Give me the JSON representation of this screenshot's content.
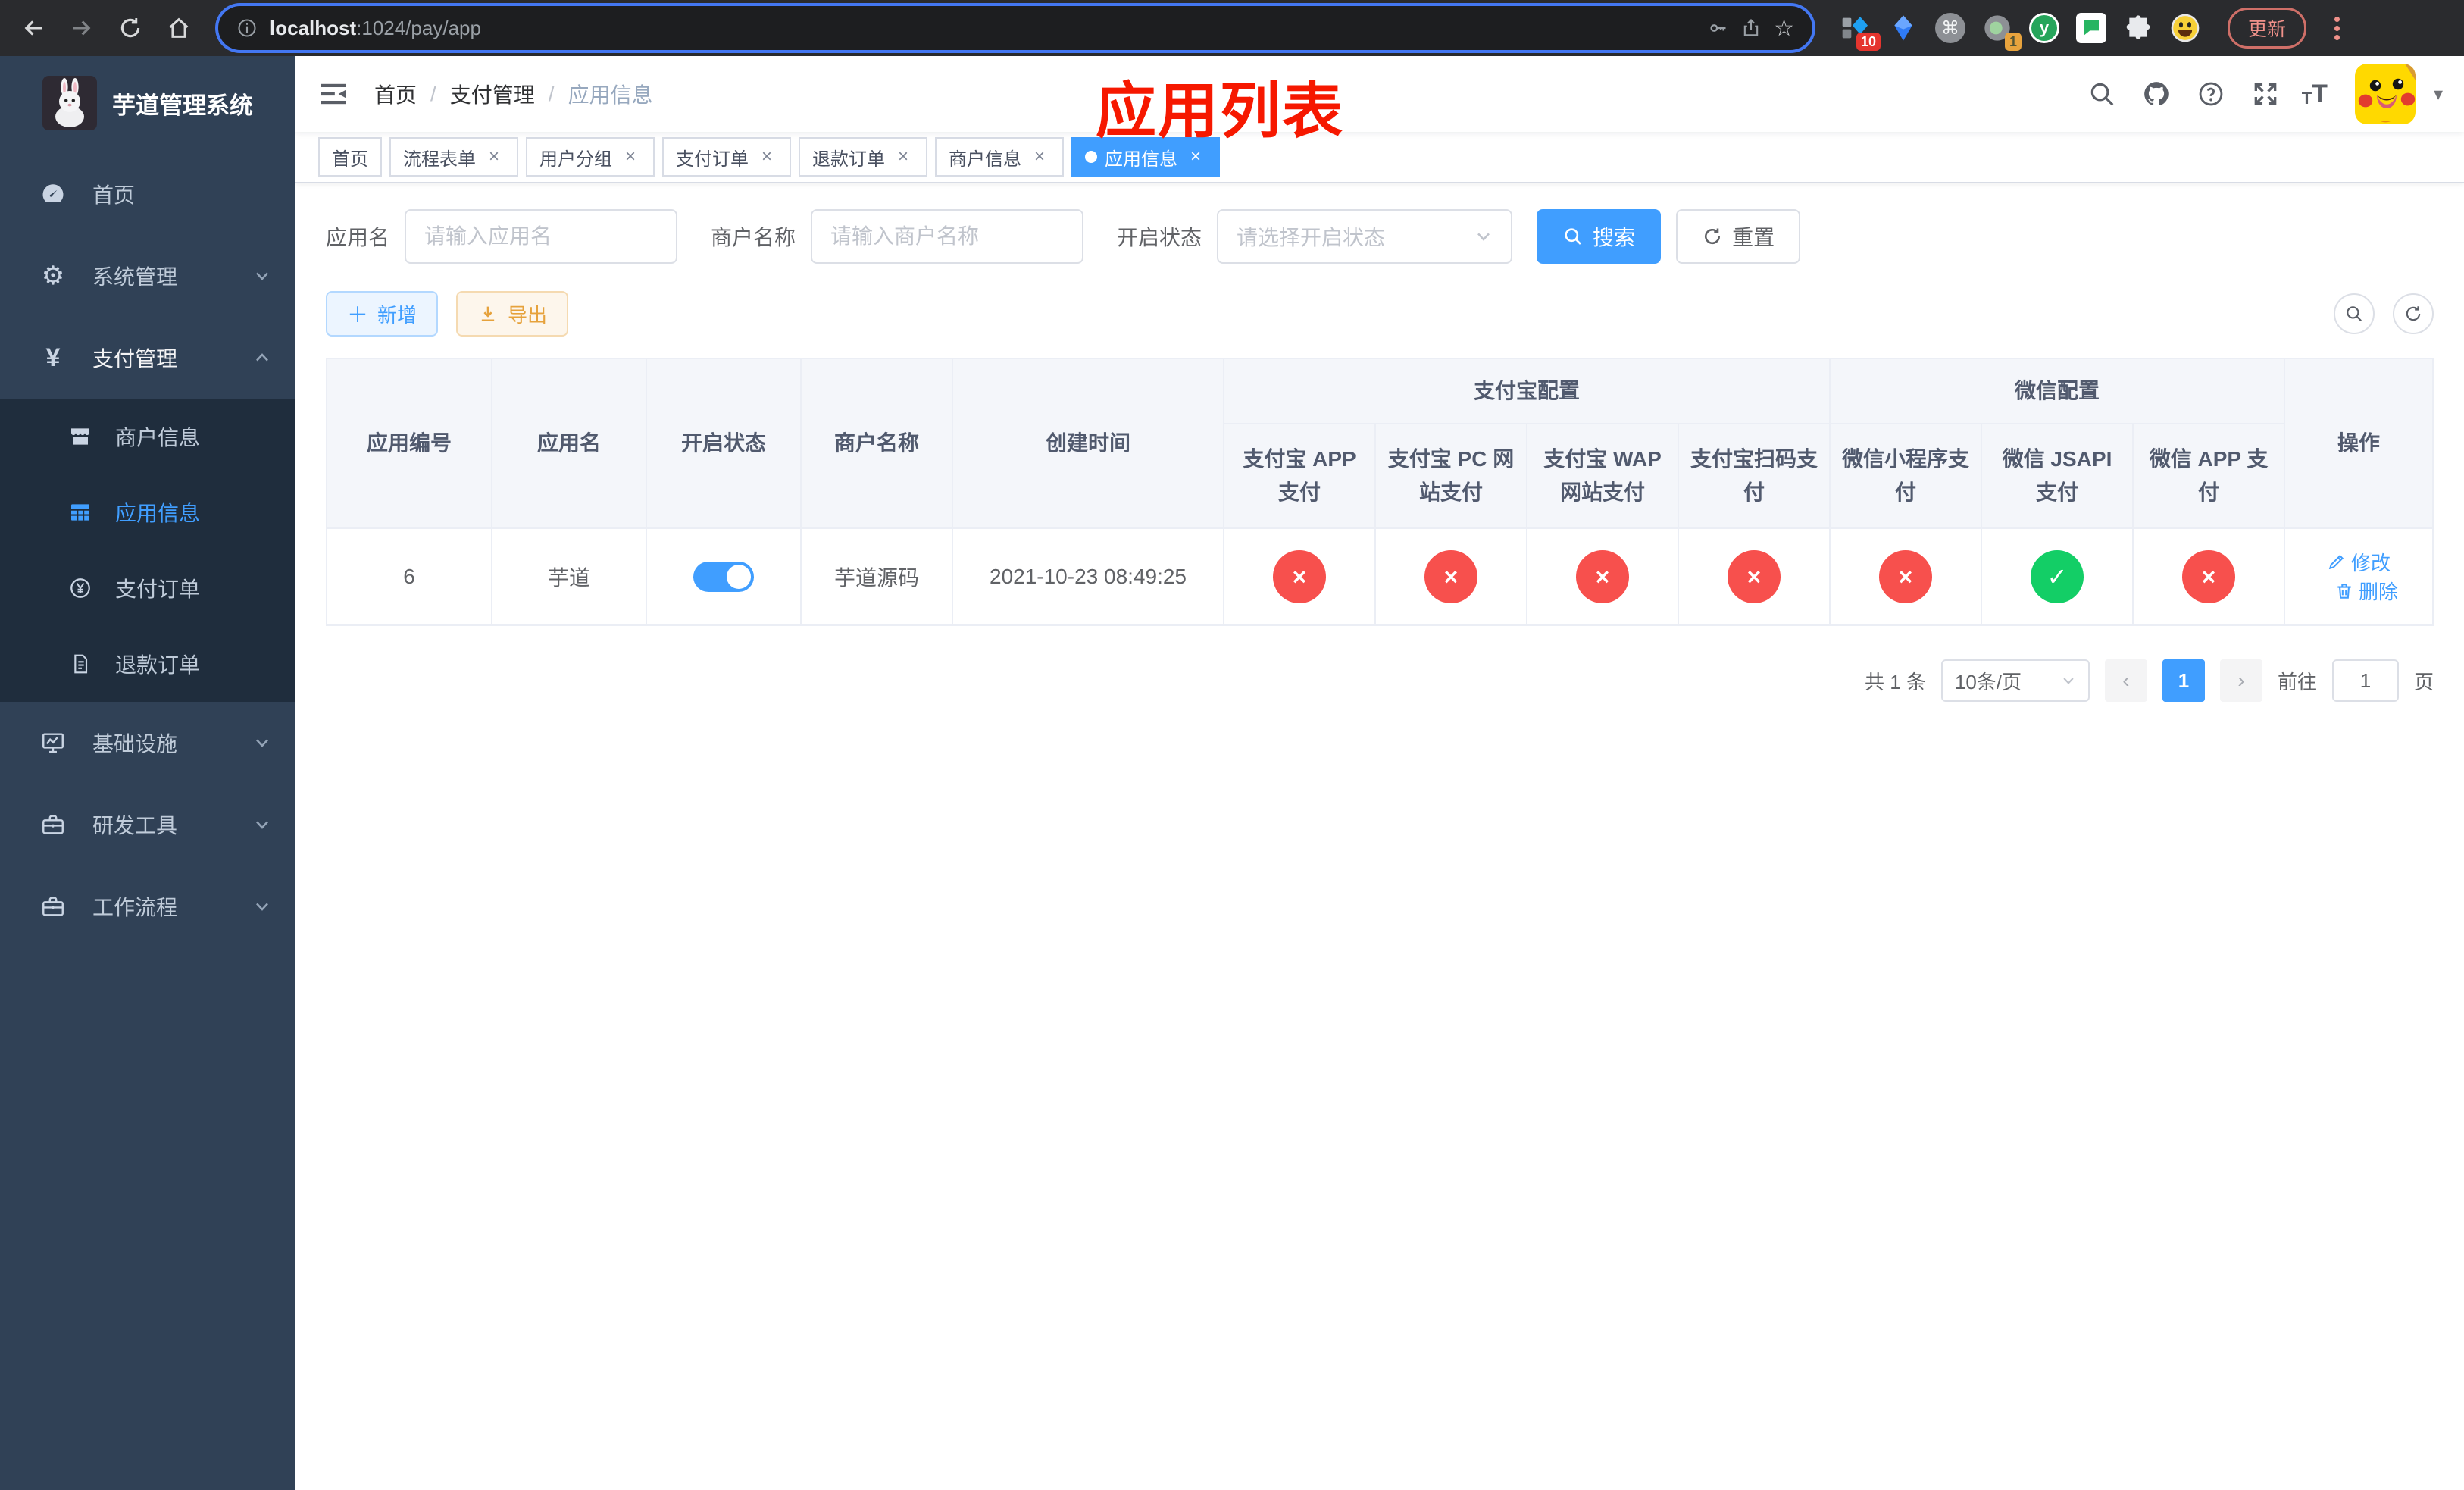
{
  "browser": {
    "url": {
      "host": "localhost",
      "path": ":1024/pay/app"
    },
    "update_button": "更新",
    "ext_badge_blue_diamond": "10",
    "ext_badge_circle": "1",
    "ext_y_label": "y"
  },
  "sidebar": {
    "logo_title": "芋道管理系统",
    "items": [
      {
        "label": "首页"
      },
      {
        "label": "系统管理"
      },
      {
        "label": "支付管理"
      },
      {
        "label": "基础设施"
      },
      {
        "label": "研发工具"
      },
      {
        "label": "工作流程"
      }
    ],
    "payment_children": [
      {
        "label": "商户信息"
      },
      {
        "label": "应用信息"
      },
      {
        "label": "支付订单"
      },
      {
        "label": "退款订单"
      }
    ]
  },
  "navbar": {
    "breadcrumb": [
      "首页",
      "支付管理",
      "应用信息"
    ],
    "annotation": "应用列表"
  },
  "tabs": [
    {
      "label": "首页"
    },
    {
      "label": "流程表单"
    },
    {
      "label": "用户分组"
    },
    {
      "label": "支付订单"
    },
    {
      "label": "退款订单"
    },
    {
      "label": "商户信息"
    },
    {
      "label": "应用信息"
    }
  ],
  "filters": {
    "app_name": {
      "label": "应用名",
      "placeholder": "请输入应用名"
    },
    "merchant_name": {
      "label": "商户名称",
      "placeholder": "请输入商户名称"
    },
    "status": {
      "label": "开启状态",
      "placeholder": "请选择开启状态"
    },
    "search": "搜索",
    "reset": "重置"
  },
  "toolbar": {
    "add": "新增",
    "export": "导出"
  },
  "table": {
    "columns": {
      "app_id": "应用编号",
      "app_name": "应用名",
      "status": "开启状态",
      "merchant_name": "商户名称",
      "create_time": "创建时间",
      "alipay_group": "支付宝配置",
      "wechat_group": "微信配置",
      "alipay_app": "支付宝 APP 支付",
      "alipay_pc": "支付宝 PC 网站支付",
      "alipay_wap": "支付宝 WAP 网站支付",
      "alipay_scan": "支付宝扫码支付",
      "wechat_mini": "微信小程序支付",
      "wechat_jsapi": "微信 JSAPI 支付",
      "wechat_app": "微信 APP 支付",
      "actions": "操作"
    },
    "rows": [
      {
        "app_id": "6",
        "app_name": "芋道",
        "status": "on",
        "merchant_name": "芋道源码",
        "create_time": "2021-10-23 08:49:25",
        "alipay_app": "disabled",
        "alipay_pc": "disabled",
        "alipay_wap": "disabled",
        "alipay_scan": "disabled",
        "wechat_mini": "disabled",
        "wechat_jsapi": "enabled",
        "wechat_app": "disabled"
      }
    ],
    "actions": {
      "edit": "修改",
      "delete": "删除"
    }
  },
  "pagination": {
    "total": "共 1 条",
    "page_size": "10条/页",
    "page": "1",
    "goto": "前往",
    "goto_value": "1",
    "unit": "页"
  },
  "colors": {
    "accent": "#409eff",
    "success": "#13ce66",
    "danger": "#f7504d",
    "warning": "#e6a23c",
    "sidebar_bg": "#304156",
    "submenu_bg": "#1f2d3d",
    "annotation_red": "#f61800"
  }
}
